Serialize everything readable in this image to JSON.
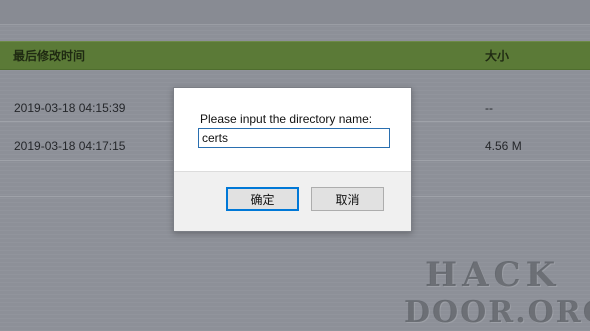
{
  "table": {
    "headers": {
      "modified": "最后修改时间",
      "size": "大小"
    },
    "rows": [
      {
        "modified": "2019-03-18 04:15:39",
        "size": "--"
      },
      {
        "modified": "2019-03-18 04:17:15",
        "size": "4.56 M"
      }
    ]
  },
  "dialog": {
    "prompt": "Please input the directory name:",
    "input_value": "certs",
    "ok_label": "确定",
    "cancel_label": "取消"
  },
  "watermark": {
    "line1": "HACK",
    "line2": "DOOR.ORG"
  },
  "colors": {
    "header_bar": "#5b7a37",
    "overlay": "#8d9098",
    "focus": "#0078d7"
  }
}
